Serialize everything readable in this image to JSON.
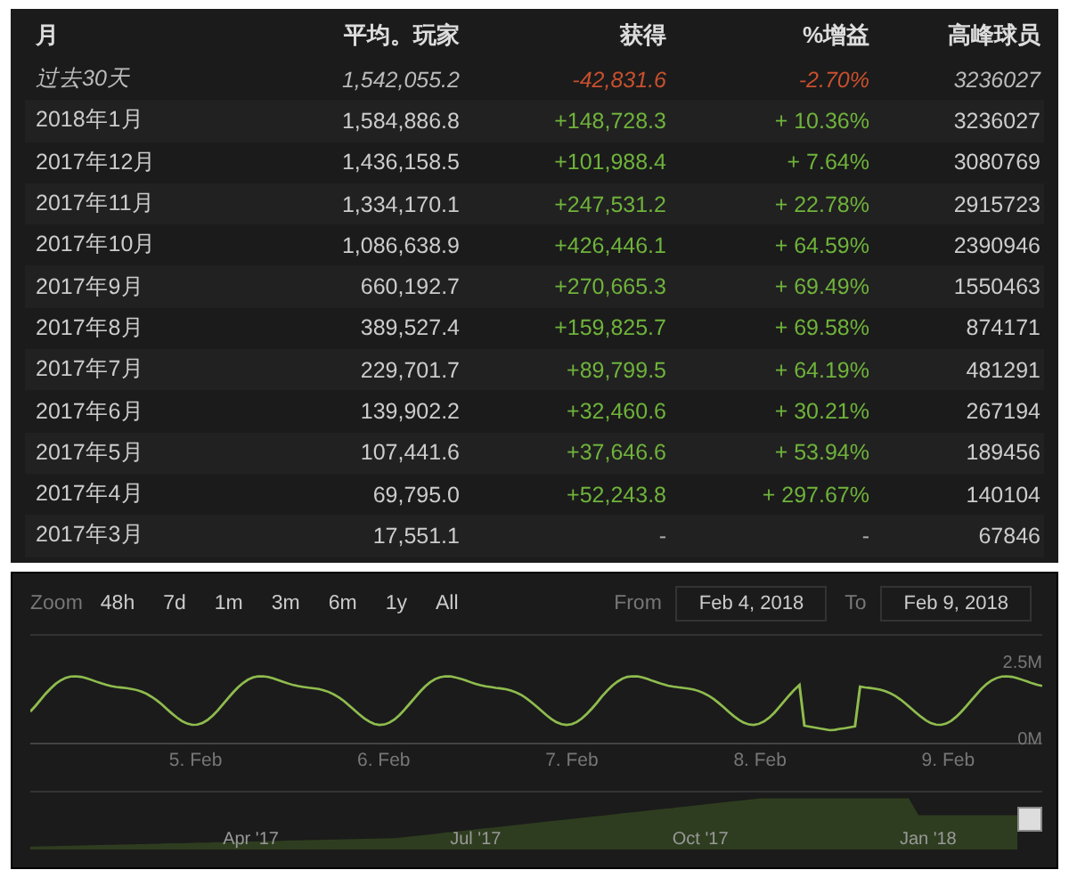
{
  "table": {
    "columns": [
      "月",
      "平均。玩家",
      "获得",
      "%增益",
      "高峰球员"
    ],
    "rows": [
      {
        "kind": "recent",
        "cells": [
          "过去30天",
          "1,542,055.2",
          "-42,831.6",
          "-2.70%",
          "3236027"
        ],
        "color": "#c8502e"
      },
      {
        "kind": "month",
        "cells": [
          "2018年1月",
          "1,584,886.8",
          "+148,728.3",
          "+ 10.36%",
          "3236027"
        ],
        "color": "#6fb33b"
      },
      {
        "kind": "month",
        "cells": [
          "2017年12月",
          "1,436,158.5",
          "+101,988.4",
          "+ 7.64%",
          "3080769"
        ],
        "color": "#6fb33b"
      },
      {
        "kind": "month",
        "cells": [
          "2017年11月",
          "1,334,170.1",
          "+247,531.2",
          "+ 22.78%",
          "2915723"
        ],
        "color": "#6fb33b"
      },
      {
        "kind": "month",
        "cells": [
          "2017年10月",
          "1,086,638.9",
          "+426,446.1",
          "+ 64.59%",
          "2390946"
        ],
        "color": "#6fb33b"
      },
      {
        "kind": "month",
        "cells": [
          "2017年9月",
          "660,192.7",
          "+270,665.3",
          "+ 69.49%",
          "1550463"
        ],
        "color": "#6fb33b"
      },
      {
        "kind": "month",
        "cells": [
          "2017年8月",
          "389,527.4",
          "+159,825.7",
          "+ 69.58%",
          "874171"
        ],
        "color": "#6fb33b"
      },
      {
        "kind": "month",
        "cells": [
          "2017年7月",
          "229,701.7",
          "+89,799.5",
          "+ 64.19%",
          "481291"
        ],
        "color": "#6fb33b"
      },
      {
        "kind": "month",
        "cells": [
          "2017年6月",
          "139,902.2",
          "+32,460.6",
          "+ 30.21%",
          "267194"
        ],
        "color": "#6fb33b"
      },
      {
        "kind": "month",
        "cells": [
          "2017年5月",
          "107,441.6",
          "+37,646.6",
          "+ 53.94%",
          "189456"
        ],
        "color": "#6fb33b"
      },
      {
        "kind": "month",
        "cells": [
          "2017年4月",
          "69,795.0",
          "+52,243.8",
          "+ 297.67%",
          "140104"
        ],
        "color": "#6fb33b"
      },
      {
        "kind": "month",
        "cells": [
          "2017年3月",
          "17,551.1",
          "-",
          "-",
          "67846"
        ],
        "color": "#aaaaaa"
      }
    ]
  },
  "chart": {
    "zoom_label": "Zoom",
    "zoom_buttons": [
      "48h",
      "7d",
      "1m",
      "3m",
      "6m",
      "1y",
      "All"
    ],
    "from_label": "From",
    "from_value": "Feb 4, 2018",
    "to_label": "To",
    "to_value": "Feb 9, 2018",
    "y_labels": [
      "2.5M",
      "0M"
    ],
    "x_labels": [
      "5. Feb",
      "6. Feb",
      "7. Feb",
      "8. Feb",
      "9. Feb"
    ],
    "navigator_labels": [
      "Apr '17",
      "Jul '17",
      "Oct '17",
      "Jan '18"
    ]
  }
}
